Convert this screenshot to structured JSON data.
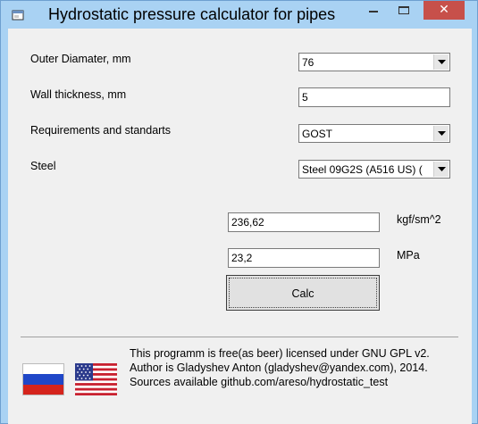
{
  "window": {
    "title": "Hydrostatic pressure calculator for pipes",
    "close_glyph": "✕"
  },
  "form": {
    "outer_diameter": {
      "label": "Outer Diamater, mm",
      "value": "76"
    },
    "wall_thickness": {
      "label": "Wall thickness, mm",
      "value": "5"
    },
    "requirements": {
      "label": "Requirements and standarts",
      "value": "GOST"
    },
    "steel": {
      "label": "Steel",
      "value": "Steel 09G2S (A516 US) ("
    }
  },
  "results": {
    "kgf": {
      "value": "236,62",
      "unit": "kgf/sm^2"
    },
    "mpa": {
      "value": "23,2",
      "unit": "MPa"
    },
    "calc_label": "Calc"
  },
  "footer": {
    "line1": "This programm is free(as beer) licensed under GNU GPL v2.",
    "line2": "Author is Gladyshev Anton (gladyshev@yandex.com), 2014.",
    "line3": "Sources available github.com/areso/hydrostatic_test"
  },
  "flags": [
    "russia-flag",
    "usa-flag"
  ],
  "colors": {
    "frame": "#a9d2f3",
    "close_button": "#c7504a",
    "client": "#f0f0f0"
  }
}
